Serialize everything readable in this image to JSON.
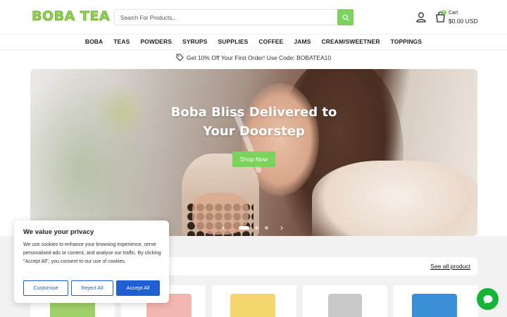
{
  "header": {
    "logo_text": "BOBA TEA",
    "logo_plus": "+",
    "search_placeholder": "Search For Products...",
    "cart_label": "Cart",
    "cart_amount": "$0.00 USD",
    "cart_count": "0",
    "icons": {
      "search": "search-icon",
      "account": "user-icon",
      "cart": "cart-icon"
    },
    "colors": {
      "accent": "#7bd35b",
      "logo": "#8fd14f"
    }
  },
  "nav": {
    "items": [
      "BOBA",
      "TEAS",
      "POWDERS",
      "SYRUPS",
      "SUPPLIES",
      "COFFEE",
      "JAMS",
      "CREAM/SWEETNER",
      "TOPPINGS"
    ]
  },
  "promo": {
    "text": "Get 10% Off Your First Order! Use Code: BOBATEA10",
    "icon": "tag-icon"
  },
  "hero": {
    "title": "Boba Bliss Delivered to Your Doorstep",
    "button": "Shop Now",
    "slide_count": 3,
    "active_slide": 1
  },
  "products": {
    "see_all": "See all product",
    "card_colors": [
      "#9fd06a",
      "#f2b7b0",
      "#f5d66c",
      "#c9c9c9",
      "#3a8fd6"
    ]
  },
  "cookie": {
    "title": "We value your privacy",
    "text": "We use cookies to enhance your browsing experience, serve personalised ads or content, and analyse our traffic. By clicking \"Accept All\", you consent to our use of cookies.",
    "customise": "Customise",
    "reject": "Reject All",
    "accept": "Accept All",
    "color": "#1f5fd1"
  },
  "chat": {
    "icon": "chat-icon",
    "color": "#13b534"
  }
}
